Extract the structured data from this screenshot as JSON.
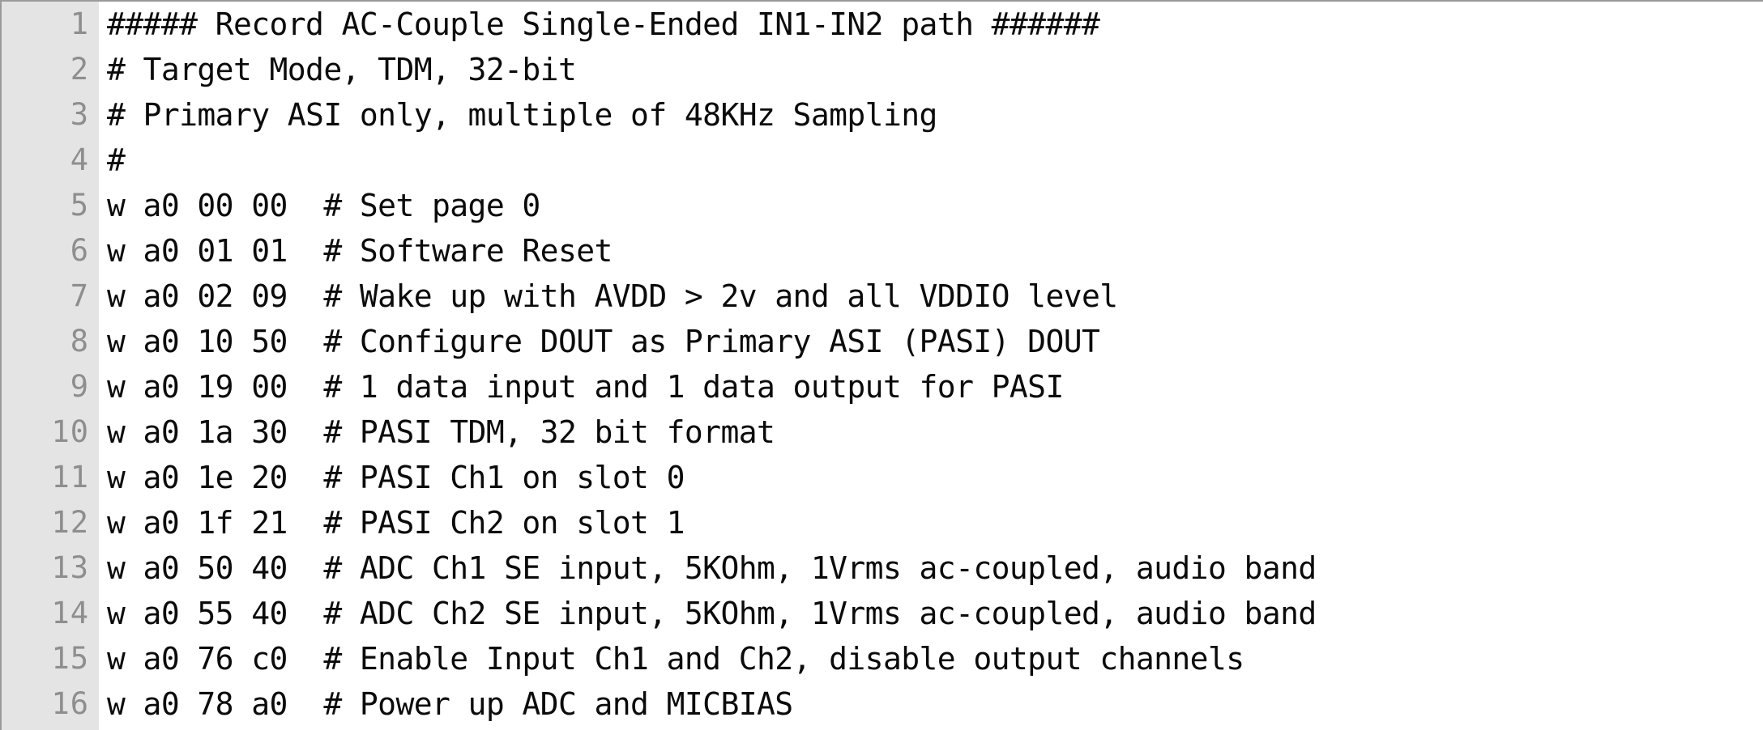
{
  "editor": {
    "gutter_background": "#e4e4e4",
    "gutter_text_color": "#8e8e8e",
    "code_background": "#ffffff",
    "code_text_color": "#0b0b0b",
    "border_color": "#9a9a9a",
    "total_lines": 16,
    "first_visible_line": 1,
    "last_visible_line": 16
  },
  "lines": [
    {
      "number": "1",
      "text": "##### Record AC-Couple Single-Ended IN1-IN2 path ######"
    },
    {
      "number": "2",
      "text": "# Target Mode, TDM, 32-bit"
    },
    {
      "number": "3",
      "text": "# Primary ASI only, multiple of 48KHz Sampling"
    },
    {
      "number": "4",
      "text": "#"
    },
    {
      "number": "5",
      "text": "w a0 00 00  # Set page 0"
    },
    {
      "number": "6",
      "text": "w a0 01 01  # Software Reset"
    },
    {
      "number": "7",
      "text": "w a0 02 09  # Wake up with AVDD > 2v and all VDDIO level"
    },
    {
      "number": "8",
      "text": "w a0 10 50  # Configure DOUT as Primary ASI (PASI) DOUT"
    },
    {
      "number": "9",
      "text": "w a0 19 00  # 1 data input and 1 data output for PASI"
    },
    {
      "number": "10",
      "text": "w a0 1a 30  # PASI TDM, 32 bit format"
    },
    {
      "number": "11",
      "text": "w a0 1e 20  # PASI Ch1 on slot 0"
    },
    {
      "number": "12",
      "text": "w a0 1f 21  # PASI Ch2 on slot 1"
    },
    {
      "number": "13",
      "text": "w a0 50 40  # ADC Ch1 SE input, 5KOhm, 1Vrms ac-coupled, audio band"
    },
    {
      "number": "14",
      "text": "w a0 55 40  # ADC Ch2 SE input, 5KOhm, 1Vrms ac-coupled, audio band"
    },
    {
      "number": "15",
      "text": "w a0 76 c0  # Enable Input Ch1 and Ch2, disable output channels"
    },
    {
      "number": "16",
      "text": "w a0 78 a0  # Power up ADC and MICBIAS"
    }
  ]
}
